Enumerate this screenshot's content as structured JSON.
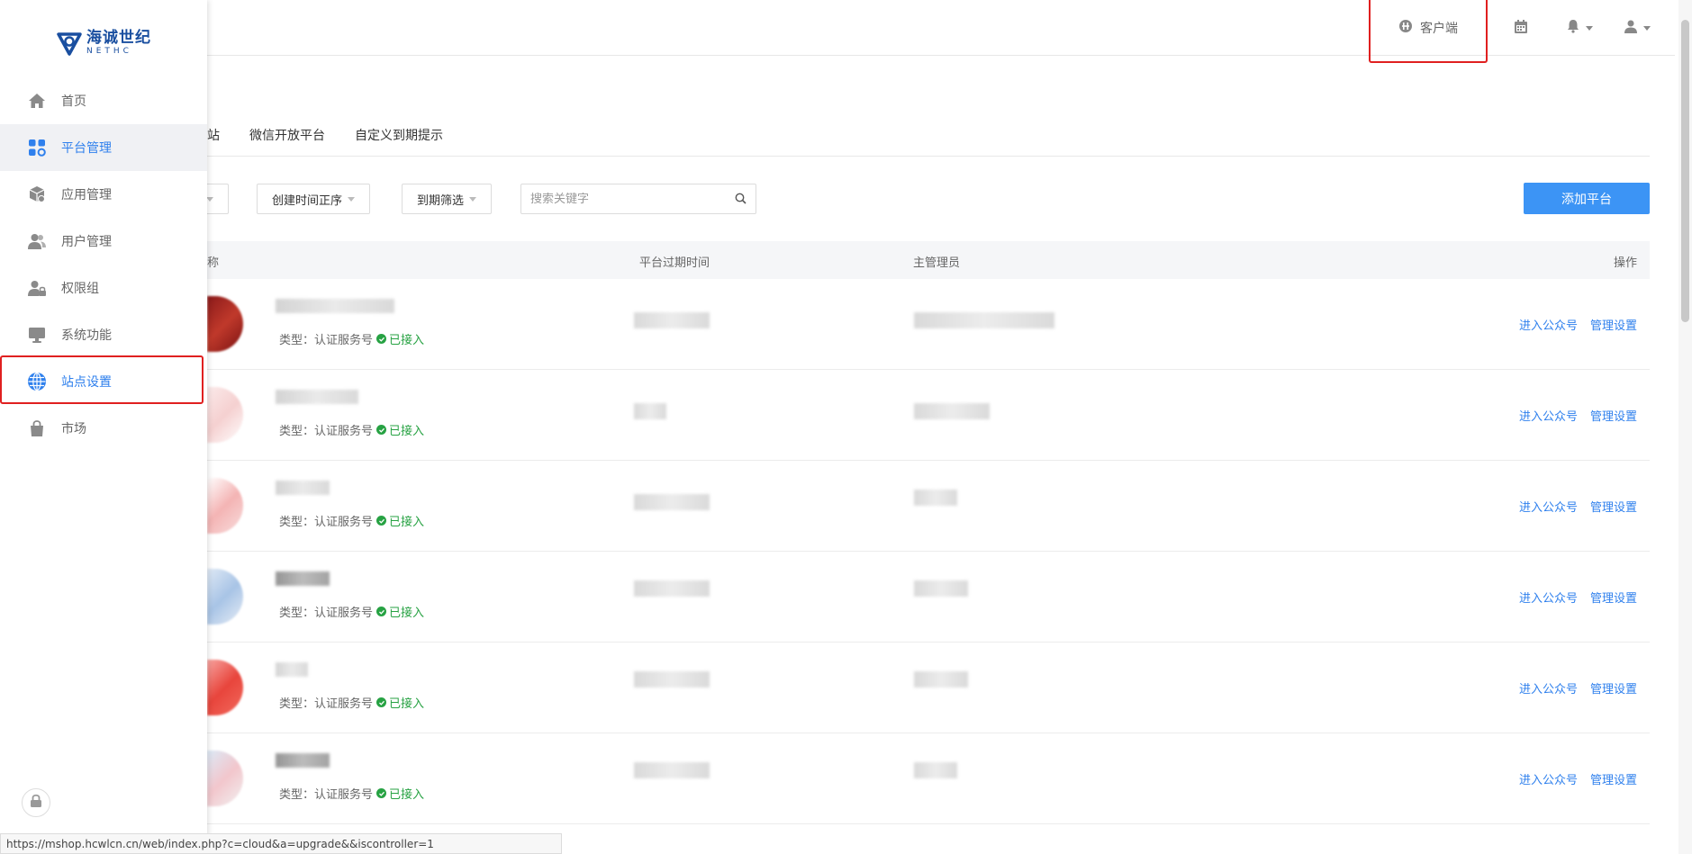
{
  "header": {
    "client_label": "客户端"
  },
  "sidebar": {
    "logo_cn": "海诚世纪",
    "logo_en": "NETHC",
    "items": [
      {
        "label": "首页",
        "icon": "home-icon"
      },
      {
        "label": "平台管理",
        "icon": "apps-icon",
        "active": true
      },
      {
        "label": "应用管理",
        "icon": "box-icon"
      },
      {
        "label": "用户管理",
        "icon": "users-icon"
      },
      {
        "label": "权限组",
        "icon": "user-lock-icon"
      },
      {
        "label": "系统功能",
        "icon": "monitor-icon"
      },
      {
        "label": "站点设置",
        "icon": "globe-icon",
        "highlighted": true
      },
      {
        "label": "市场",
        "icon": "bag-icon"
      }
    ]
  },
  "tabs": [
    "站",
    "微信开放平台",
    "自定义到期提示"
  ],
  "filters": {
    "sort_label": "创建时间正序",
    "expire_label": "到期筛选",
    "search_placeholder": "搜索关键字",
    "add_button": "添加平台"
  },
  "table": {
    "columns": [
      "称",
      "平台过期时间",
      "主管理员",
      "操作"
    ],
    "rows": [
      {
        "type_label": "类型：认证服务号",
        "status": "已接入",
        "action1": "进入公众号",
        "action2": "管理设置"
      },
      {
        "type_label": "类型：认证服务号",
        "status": "已接入",
        "action1": "进入公众号",
        "action2": "管理设置"
      },
      {
        "type_label": "类型：认证服务号",
        "status": "已接入",
        "action1": "进入公众号",
        "action2": "管理设置"
      },
      {
        "type_label": "类型：认证服务号",
        "status": "已接入",
        "action1": "进入公众号",
        "action2": "管理设置"
      },
      {
        "type_label": "类型：认证服务号",
        "status": "已接入",
        "action1": "进入公众号",
        "action2": "管理设置"
      },
      {
        "type_label": "类型：认证服务号",
        "status": "已接入",
        "action1": "进入公众号",
        "action2": "管理设置"
      }
    ]
  },
  "statusbar": {
    "url": "https://mshop.hcwlcn.cn/web/index.php?c=cloud&a=upgrade&&iscontroller=1"
  },
  "colors": {
    "accent": "#2f80ed",
    "button": "#3c94f5",
    "success": "#27a243",
    "highlight": "#e02020"
  }
}
